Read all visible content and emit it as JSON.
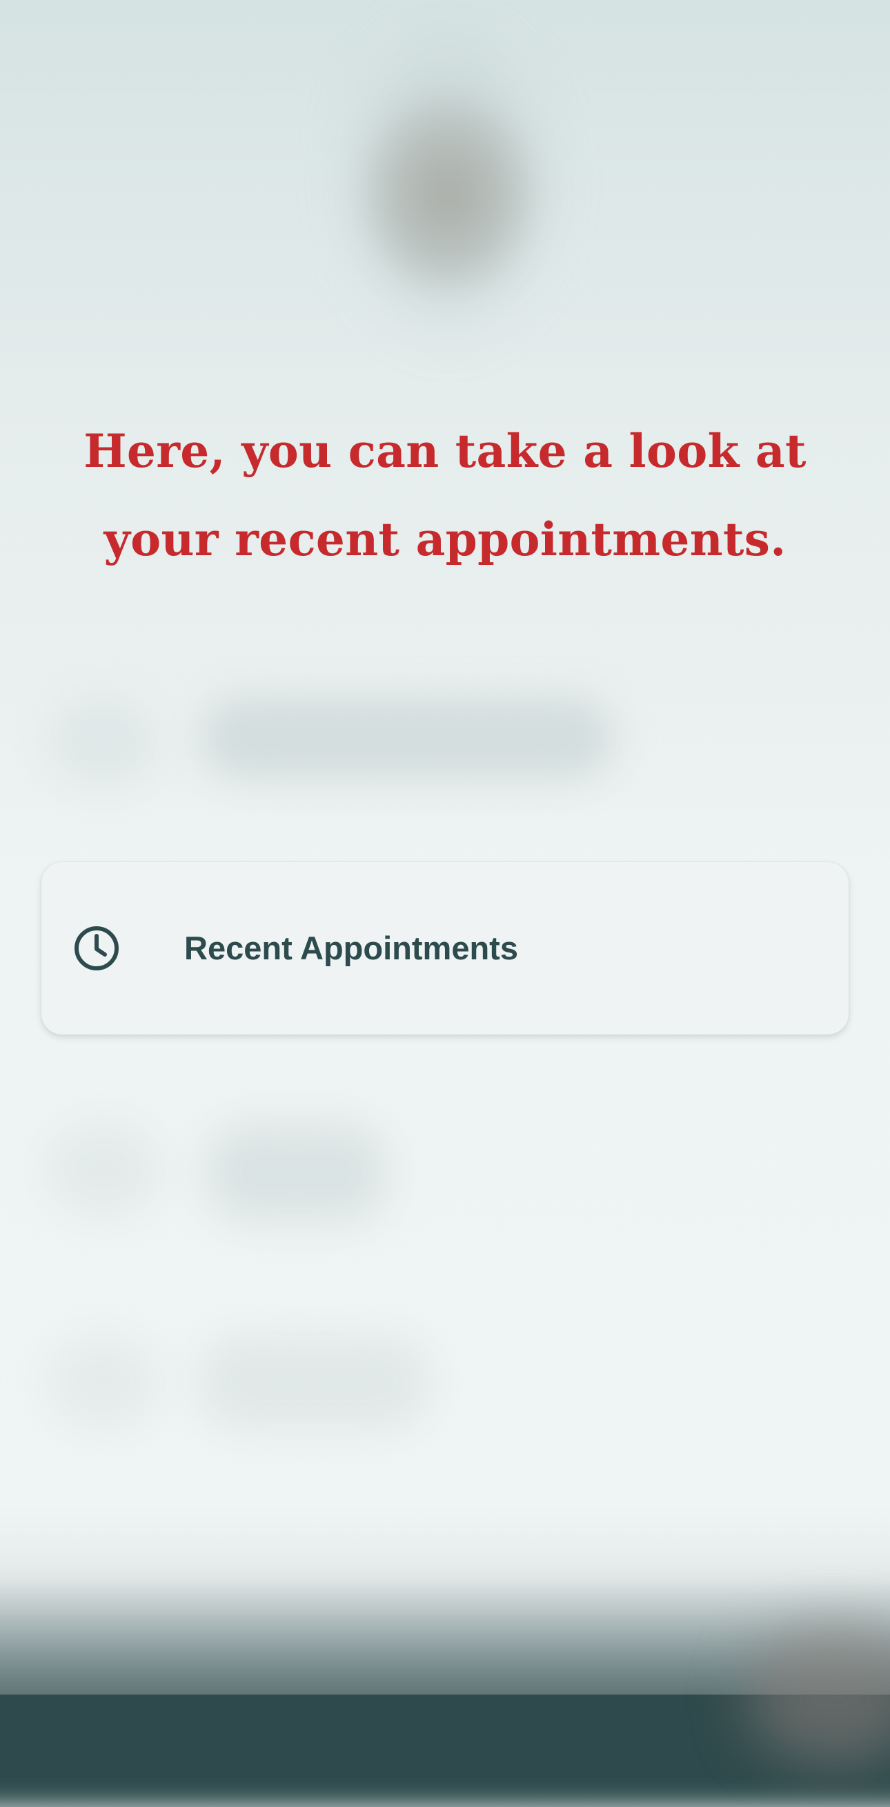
{
  "onboarding": {
    "headline": "Here, you can take a look at your recent appointments."
  },
  "menu": {
    "highlighted_item": {
      "icon": "clock-icon",
      "label": "Recent Appointments"
    }
  },
  "colors": {
    "headline": "#c62a2d",
    "card_text": "#2d4a4c",
    "card_background": "#eff3f4",
    "bottom_bar": "#2f4a4c"
  }
}
